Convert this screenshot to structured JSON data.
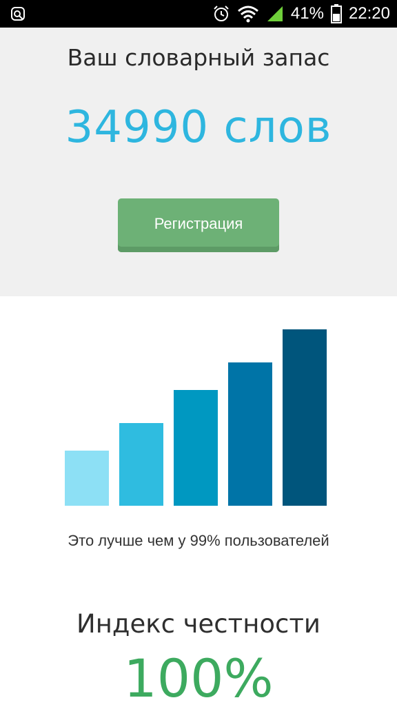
{
  "status_bar": {
    "battery_percent": "41%",
    "time": "22:20",
    "icons": [
      "notification-icon",
      "alarm-icon",
      "wifi-icon",
      "signal-icon",
      "battery-icon"
    ]
  },
  "header": {
    "title": "Ваш словарный запас",
    "vocab_count": "34990 слов",
    "register_label": "Регистрация"
  },
  "chart_data": {
    "type": "bar",
    "categories": [
      "",
      "",
      "",
      "",
      ""
    ],
    "values": [
      80,
      120,
      168,
      208,
      256
    ],
    "colors": [
      "#8de0f5",
      "#2fbce0",
      "#0098c1",
      "#0074a7",
      "#00557c"
    ]
  },
  "summary": {
    "comparison_text": "Это лучше чем у 99% пользователей"
  },
  "honesty": {
    "title": "Индекс честности",
    "value": "100%"
  }
}
